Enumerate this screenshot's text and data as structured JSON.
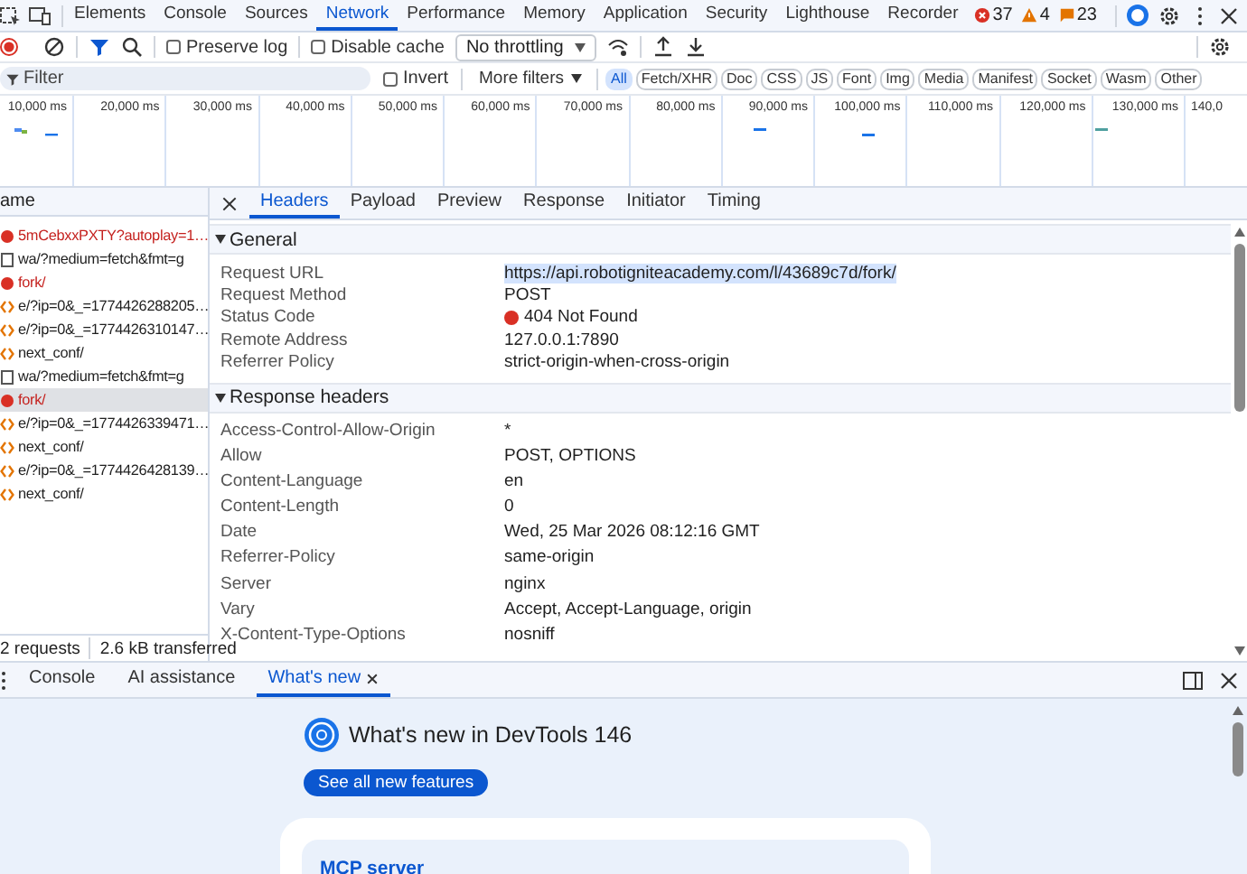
{
  "panel_tabs": [
    {
      "label": "Elements",
      "selected": false
    },
    {
      "label": "Console",
      "selected": false
    },
    {
      "label": "Sources",
      "selected": false
    },
    {
      "label": "Network",
      "selected": true
    },
    {
      "label": "Performance",
      "selected": false
    },
    {
      "label": "Memory",
      "selected": false
    },
    {
      "label": "Application",
      "selected": false
    },
    {
      "label": "Security",
      "selected": false
    },
    {
      "label": "Lighthouse",
      "selected": false
    },
    {
      "label": "Recorder",
      "selected": false
    }
  ],
  "issue_counts": [
    {
      "kind": "error",
      "count": "37"
    },
    {
      "kind": "warning",
      "count": "4"
    },
    {
      "kind": "info",
      "count": "23"
    }
  ],
  "toolbar": {
    "preserve_log": {
      "label": "Preserve log",
      "checked": false
    },
    "disable_cache": {
      "label": "Disable cache",
      "checked": false
    },
    "throttling": "No throttling"
  },
  "filter": {
    "placeholder": "Filter",
    "invert": {
      "label": "Invert",
      "checked": false
    },
    "more_filters": "More filters",
    "types": [
      {
        "label": "All",
        "selected": true
      },
      {
        "label": "Fetch/XHR",
        "selected": false
      },
      {
        "label": "Doc",
        "selected": false
      },
      {
        "label": "CSS",
        "selected": false
      },
      {
        "label": "JS",
        "selected": false
      },
      {
        "label": "Font",
        "selected": false
      },
      {
        "label": "Img",
        "selected": false
      },
      {
        "label": "Media",
        "selected": false
      },
      {
        "label": "Manifest",
        "selected": false
      },
      {
        "label": "Socket",
        "selected": false
      },
      {
        "label": "Wasm",
        "selected": false
      },
      {
        "label": "Other",
        "selected": false
      }
    ]
  },
  "overview": {
    "ticks": [
      "10,000 ms",
      "20,000 ms",
      "30,000 ms",
      "40,000 ms",
      "50,000 ms",
      "60,000 ms",
      "70,000 ms",
      "80,000 ms",
      "90,000 ms",
      "100,000 ms",
      "110,000 ms",
      "120,000 ms",
      "130,000 ms",
      "140,0"
    ]
  },
  "requests": {
    "column": "ame",
    "rows": [
      {
        "name": "5mCebxxPXTY?autoplay=1…",
        "kind": "error",
        "selected": false
      },
      {
        "name": "wa/?medium=fetch&fmt=g",
        "kind": "document",
        "selected": false
      },
      {
        "name": "fork/",
        "kind": "error",
        "selected": false
      },
      {
        "name": "e/?ip=0&_=1774426288205…",
        "kind": "fetch",
        "selected": false
      },
      {
        "name": "e/?ip=0&_=1774426310147…",
        "kind": "fetch",
        "selected": false
      },
      {
        "name": "next_conf/",
        "kind": "fetch",
        "selected": false
      },
      {
        "name": "wa/?medium=fetch&fmt=g",
        "kind": "document",
        "selected": false
      },
      {
        "name": "fork/",
        "kind": "error",
        "selected": true
      },
      {
        "name": "e/?ip=0&_=1774426339471…",
        "kind": "fetch",
        "selected": false
      },
      {
        "name": "next_conf/",
        "kind": "fetch",
        "selected": false
      },
      {
        "name": "e/?ip=0&_=1774426428139…",
        "kind": "fetch",
        "selected": false
      },
      {
        "name": "next_conf/",
        "kind": "fetch",
        "selected": false
      }
    ],
    "summary": [
      "2 requests",
      "2.6 kB transferred"
    ]
  },
  "details": {
    "tabs": [
      {
        "label": "Headers",
        "selected": true
      },
      {
        "label": "Payload",
        "selected": false
      },
      {
        "label": "Preview",
        "selected": false
      },
      {
        "label": "Response",
        "selected": false
      },
      {
        "label": "Initiator",
        "selected": false
      },
      {
        "label": "Timing",
        "selected": false
      }
    ],
    "sections": [
      {
        "title": "General",
        "expanded": true,
        "rows": [
          {
            "name": "Request URL",
            "value": "https://api.robotigniteacademy.com/l/43689c7d/fork/",
            "kind": "url"
          },
          {
            "name": "Request Method",
            "value": "POST",
            "kind": "text"
          },
          {
            "name": "Status Code",
            "value": "404 Not Found",
            "kind": "error_status"
          },
          {
            "name": "Remote Address",
            "value": "127.0.0.1:7890",
            "kind": "text"
          },
          {
            "name": "Referrer Policy",
            "value": "strict-origin-when-cross-origin",
            "kind": "text"
          }
        ]
      },
      {
        "title": "Response headers",
        "expanded": true,
        "rows": [
          {
            "name": "Access-Control-Allow-Origin",
            "value": "*",
            "kind": "text"
          },
          {
            "name": "Allow",
            "value": "POST, OPTIONS",
            "kind": "text"
          },
          {
            "name": "Content-Language",
            "value": "en",
            "kind": "text"
          },
          {
            "name": "Content-Length",
            "value": "0",
            "kind": "text"
          },
          {
            "name": "Date",
            "value": "Wed, 25 Mar 2026 08:12:16 GMT",
            "kind": "text"
          },
          {
            "name": "Referrer-Policy",
            "value": "same-origin",
            "kind": "text"
          },
          {
            "name": "Server",
            "value": "nginx",
            "kind": "text"
          },
          {
            "name": "Vary",
            "value": "Accept, Accept-Language, origin",
            "kind": "text"
          },
          {
            "name": "X-Content-Type-Options",
            "value": "nosniff",
            "kind": "text"
          }
        ]
      }
    ]
  },
  "drawer": {
    "tabs": [
      {
        "label": "Console",
        "selected": false,
        "closable": false
      },
      {
        "label": "AI assistance",
        "selected": false,
        "closable": false
      },
      {
        "label": "What's new",
        "selected": true,
        "closable": true
      }
    ],
    "whats_new": {
      "title": "What's new in DevTools 146",
      "button": "See all new features",
      "card_link": "MCP server"
    }
  }
}
